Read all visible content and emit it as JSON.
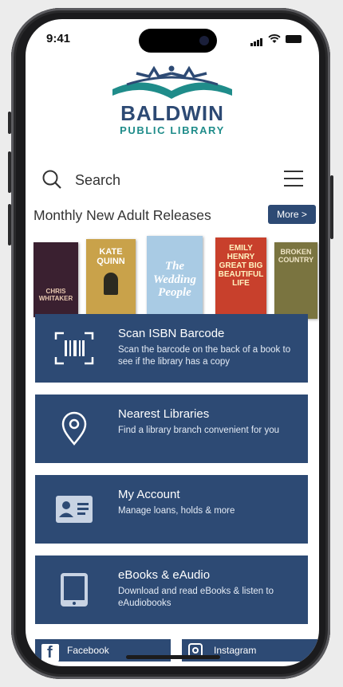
{
  "status": {
    "time": "9:41"
  },
  "logo": {
    "name": "BALDWIN",
    "subtitle": "PUBLIC LIBRARY"
  },
  "search": {
    "label": "Search"
  },
  "section": {
    "title": "Monthly New Adult Releases",
    "more_label": "More >"
  },
  "books": [
    {
      "cover_text": "CHRIS WHITAKER",
      "color": "#3a2030"
    },
    {
      "cover_text": "KATE QUINN",
      "color": "#c9a24a"
    },
    {
      "cover_text": "The Wedding People",
      "color": "#a9cbe4"
    },
    {
      "cover_text": "EMILY HENRY GREAT BIG BEAUTIFUL LIFE",
      "color": "#c8402c"
    },
    {
      "cover_text": "BROKEN COUNTRY",
      "color": "#7a7440"
    }
  ],
  "cards": [
    {
      "icon": "barcode-icon",
      "title": "Scan ISBN Barcode",
      "desc": "Scan the barcode on the back of a book to see if the library has a copy"
    },
    {
      "icon": "location-pin-icon",
      "title": "Nearest Libraries",
      "desc": "Find a library branch convenient for you"
    },
    {
      "icon": "id-card-icon",
      "title": "My Account",
      "desc": "Manage loans, holds & more"
    },
    {
      "icon": "tablet-icon",
      "title": "eBooks & eAudio",
      "desc": "Download and read eBooks & listen to eAudiobooks"
    }
  ],
  "social": {
    "facebook": "Facebook",
    "instagram": "Instagram"
  },
  "colors": {
    "primary": "#2d4a74",
    "teal": "#1f8c8a"
  }
}
